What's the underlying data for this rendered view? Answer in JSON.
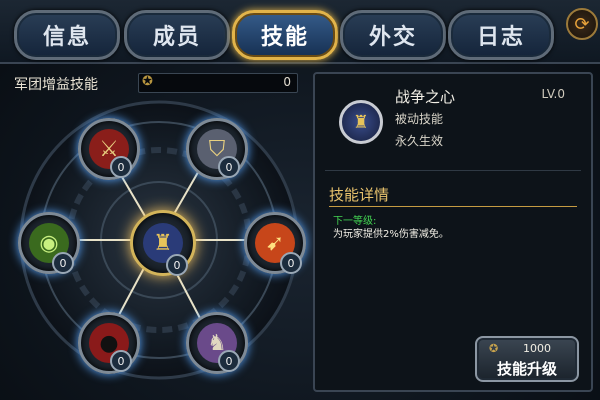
{
  "tabs": [
    {
      "label": "信息",
      "active": false
    },
    {
      "label": "成员",
      "active": false
    },
    {
      "label": "技能",
      "active": true
    },
    {
      "label": "外交",
      "active": false
    },
    {
      "label": "日志",
      "active": false
    }
  ],
  "refresh_icon": "refresh-icon",
  "left": {
    "title": "军团增益技能",
    "points_value": "0",
    "points_icon": "legion-emblem-icon"
  },
  "tree": {
    "nodes": [
      {
        "id": "crossed-swords",
        "icon": "crossed-swords-icon",
        "glyph": "⚔",
        "level": "0",
        "bg": "#8a1e1a"
      },
      {
        "id": "shield",
        "icon": "shield-icon",
        "glyph": "⛉",
        "level": "0",
        "bg": "#6a7080"
      },
      {
        "id": "warrior-eyes",
        "icon": "warrior-eyes-icon",
        "glyph": "◉",
        "level": "0",
        "bg": "#3a6a1e"
      },
      {
        "id": "heart-of-war",
        "icon": "lion-shield-icon",
        "glyph": "♜",
        "level": "0",
        "bg": "#2a3b78"
      },
      {
        "id": "blade-strike",
        "icon": "blade-strike-icon",
        "glyph": "➹",
        "level": "0",
        "bg": "#c7461a"
      },
      {
        "id": "shadow-figure",
        "icon": "shadow-figure-icon",
        "glyph": "●",
        "level": "0",
        "bg": "#8a1a1a"
      },
      {
        "id": "armored-knight",
        "icon": "armored-knight-icon",
        "glyph": "♞",
        "level": "0",
        "bg": "#6a4a8a"
      }
    ]
  },
  "detail": {
    "name": "战争之心",
    "level": "LV.0",
    "type": "被动技能",
    "duration": "永久生效",
    "section_title": "技能详情",
    "next_level_label": "下一等级:",
    "next_level_desc": "为玩家提供2%伤害减免。",
    "upgrade_cost": "1000",
    "upgrade_label": "技能升级",
    "cost_icon": "legion-emblem-icon"
  }
}
